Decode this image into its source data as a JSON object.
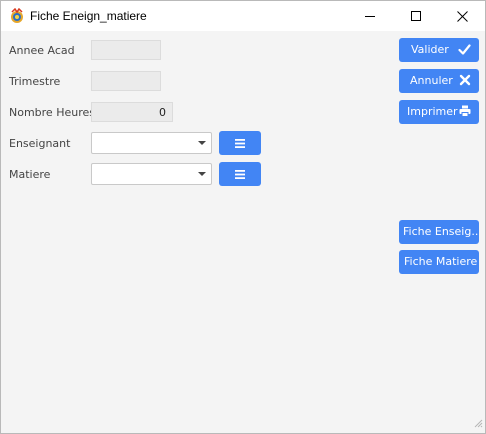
{
  "window": {
    "title": "Fiche Eneign_matiere",
    "icon": "app-logo-icon"
  },
  "form": {
    "annee_acad": {
      "label": "Annee Acad",
      "value": ""
    },
    "trimestre": {
      "label": "Trimestre",
      "value": ""
    },
    "nombre_heures": {
      "label": "Nombre Heures",
      "value": "0"
    },
    "enseignant": {
      "label": "Enseignant",
      "value": ""
    },
    "matiere": {
      "label": "Matiere",
      "value": ""
    }
  },
  "buttons": {
    "valider": "Valider",
    "annuler": "Annuler",
    "imprimer": "Imprimer",
    "fiche_enseignant": "Fiche Enseig...",
    "fiche_matiere": "Fiche Matiere"
  },
  "colors": {
    "accent": "#4285f4",
    "window_bg": "#f4f4f4",
    "titlebar_bg": "#ffffff"
  }
}
